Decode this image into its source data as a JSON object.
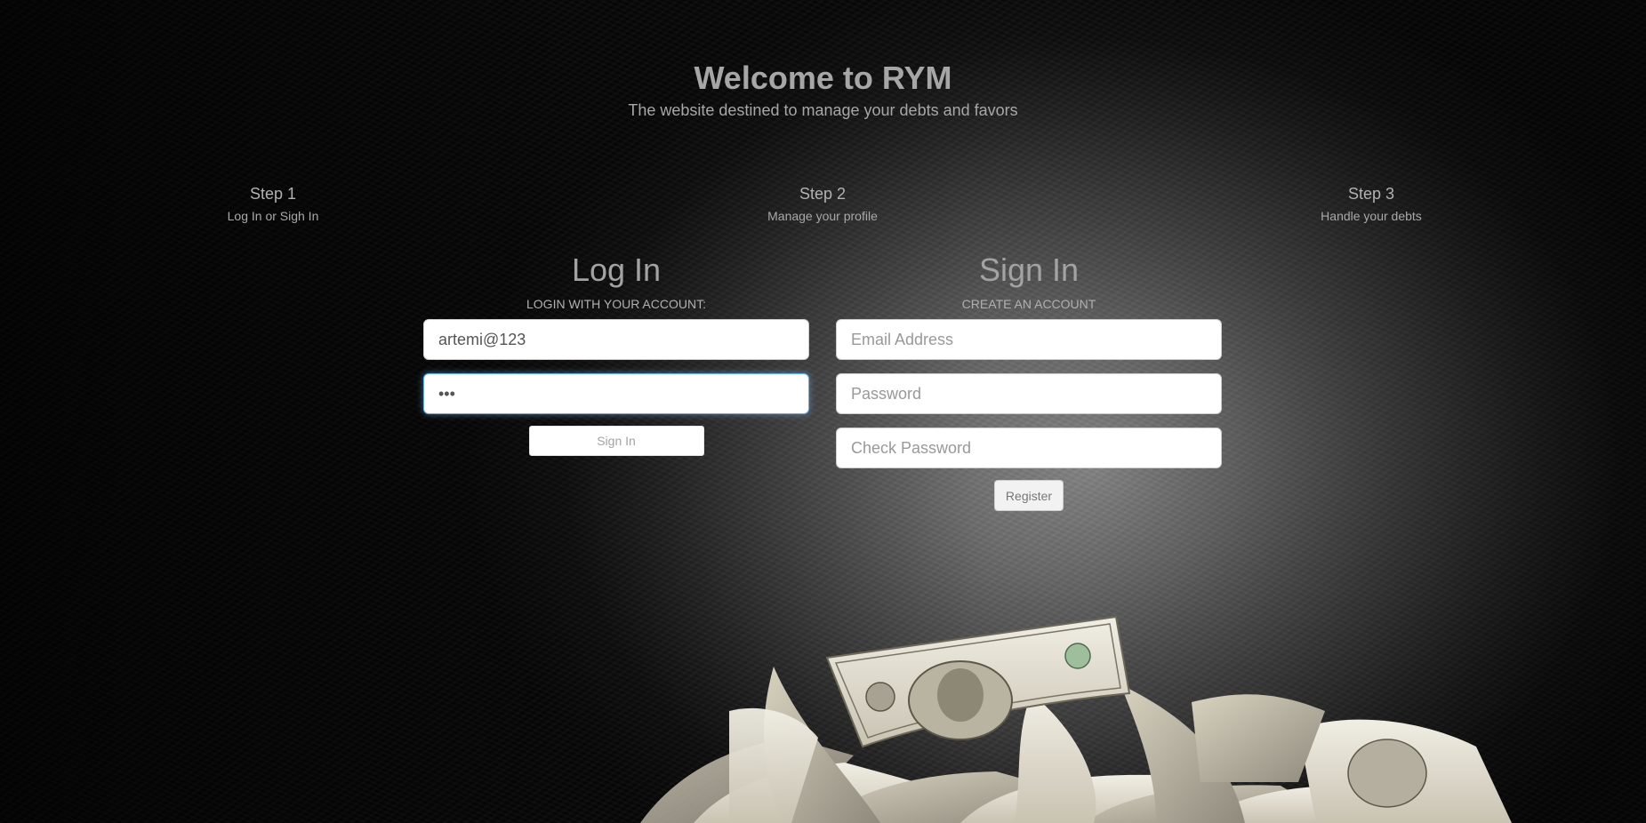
{
  "header": {
    "title": "Welcome to RYM",
    "subtitle": "The website destined to manage your debts and favors"
  },
  "steps": [
    {
      "title": "Step 1",
      "description": "Log In or Sigh In"
    },
    {
      "title": "Step 2",
      "description": "Manage your profile"
    },
    {
      "title": "Step 3",
      "description": "Handle your debts"
    }
  ],
  "login": {
    "heading": "Log In",
    "subtitle": "LOGIN WITH YOUR ACCOUNT:",
    "username_value": "artemi@123",
    "password_value": "•••",
    "submit_label": "Sign In"
  },
  "signup": {
    "heading": "Sign In",
    "subtitle": "CREATE AN ACCOUNT",
    "email_placeholder": "Email Address",
    "password_placeholder": "Password",
    "check_password_placeholder": "Check Password",
    "submit_label": "Register"
  },
  "colors": {
    "text_primary": "#a6a6a6",
    "focus_border": "#66afe9",
    "input_bg": "#ffffff"
  },
  "icons": {
    "background_image": "money-pile-illustration"
  }
}
